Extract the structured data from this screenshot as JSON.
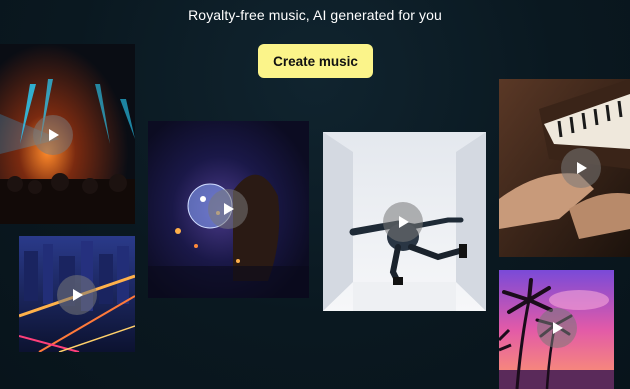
{
  "header": {
    "headline": "Royalty-free music, AI generated for you"
  },
  "cta": {
    "label": "Create music",
    "color": "#fbf48a"
  },
  "gallery": {
    "tiles": [
      {
        "scene": "concert crowd with stage lights",
        "icon": "play-icon"
      },
      {
        "scene": "city lights at night aerial",
        "icon": "play-icon"
      },
      {
        "scene": "woman with disco ball",
        "icon": "play-icon"
      },
      {
        "scene": "dancer jumping in white room",
        "icon": "play-icon"
      },
      {
        "scene": "hands playing piano",
        "icon": "play-icon"
      },
      {
        "scene": "palm trees at sunset",
        "icon": "play-icon"
      }
    ]
  }
}
